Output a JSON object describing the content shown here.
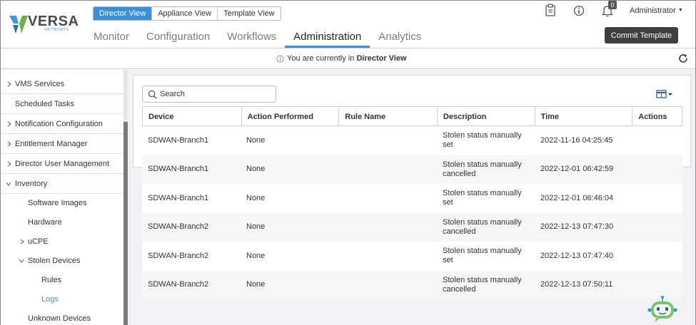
{
  "brand": {
    "name": "VERSA",
    "subtitle": "NETWORKS"
  },
  "view_switch": [
    {
      "label": "Director View",
      "active": true
    },
    {
      "label": "Appliance View",
      "active": false
    },
    {
      "label": "Template View",
      "active": false
    }
  ],
  "main_nav": [
    {
      "label": "Monitor",
      "active": false
    },
    {
      "label": "Configuration",
      "active": false
    },
    {
      "label": "Workflows",
      "active": false
    },
    {
      "label": "Administration",
      "active": true
    },
    {
      "label": "Analytics",
      "active": false
    }
  ],
  "header": {
    "icons": [
      "clipboard-icon",
      "info-icon",
      "bell-icon"
    ],
    "notification_count": "0",
    "user_menu": "Administrator",
    "commit_button": "Commit Template"
  },
  "context": {
    "prefix": "You are currently in",
    "view": "Director View"
  },
  "sidebar": {
    "items": [
      {
        "label": "VMS Services",
        "chevron": "right"
      },
      {
        "label": "Scheduled Tasks",
        "chevron": "none"
      },
      {
        "label": "Notification Configuration",
        "chevron": "right"
      },
      {
        "label": "Entitlement Manager",
        "chevron": "right"
      },
      {
        "label": "Director User Management",
        "chevron": "right"
      },
      {
        "label": "Inventory",
        "chevron": "down"
      },
      {
        "label": "Software Images",
        "chevron": "none"
      },
      {
        "label": "Hardware",
        "chevron": "none"
      },
      {
        "label": "uCPE",
        "chevron": "right"
      },
      {
        "label": "Stolen Devices",
        "chevron": "down"
      },
      {
        "label": "Rules",
        "chevron": "none"
      },
      {
        "label": "Logs",
        "chevron": "none",
        "selected": true
      },
      {
        "label": "Unknown Devices",
        "chevron": "none"
      }
    ]
  },
  "search": {
    "placeholder": "Search",
    "value": ""
  },
  "table": {
    "columns": [
      "Device",
      "Action Performed",
      "Rule Name",
      "Description",
      "Time",
      "Actions"
    ],
    "rows": [
      {
        "device": "SDWAN-Branch1",
        "action": "None",
        "rule": "",
        "desc1": "Stolen status manually",
        "desc2": "set",
        "time": "2022-11-16 04:25:45"
      },
      {
        "device": "SDWAN-Branch1",
        "action": "None",
        "rule": "",
        "desc1": "Stolen status manually",
        "desc2": "cancelled",
        "time": "2022-12-01 06:42:59"
      },
      {
        "device": "SDWAN-Branch1",
        "action": "None",
        "rule": "",
        "desc1": "Stolen status manually",
        "desc2": "set",
        "time": "2022-12-01 06:46:04"
      },
      {
        "device": "SDWAN-Branch2",
        "action": "None",
        "rule": "",
        "desc1": "Stolen status manually",
        "desc2": "cancelled",
        "time": "2022-12-13 07:47:30"
      },
      {
        "device": "SDWAN-Branch2",
        "action": "None",
        "rule": "",
        "desc1": "Stolen status manually",
        "desc2": "set",
        "time": "2022-12-13 07:47:40"
      },
      {
        "device": "SDWAN-Branch2",
        "action": "None",
        "rule": "",
        "desc1": "Stolen status manually",
        "desc2": "cancelled",
        "time": "2022-12-13 07:50:11"
      }
    ]
  },
  "colors": {
    "accent": "#3a8fd6",
    "dark_button": "#3f3f3f",
    "content_bg": "#f0f2f5"
  }
}
